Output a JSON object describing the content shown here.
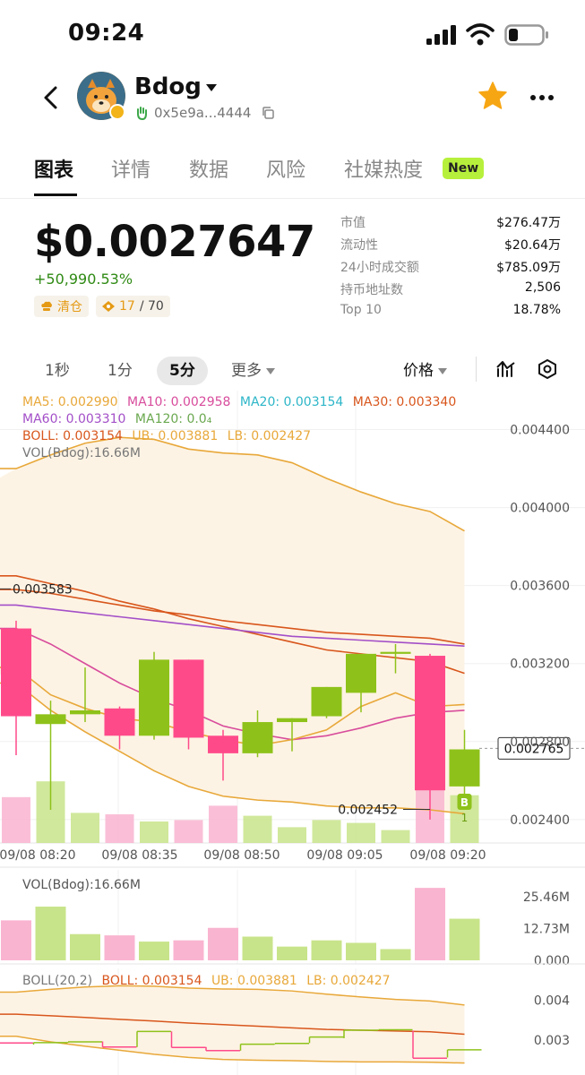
{
  "status_bar": {
    "time": "09:24"
  },
  "header": {
    "token_name": "Bdog",
    "address": "0x5e9a...4444"
  },
  "tabs": [
    {
      "label": "图表",
      "active": true
    },
    {
      "label": "详情",
      "active": false
    },
    {
      "label": "数据",
      "active": false
    },
    {
      "label": "风险",
      "active": false
    },
    {
      "label": "社媒热度",
      "active": false,
      "badge": "New"
    }
  ],
  "price": {
    "value": "$0.0027647",
    "change": "+50,990.53%",
    "pill_clear": "清仓",
    "pill_count": "17",
    "pill_total": "/ 70"
  },
  "stats": [
    {
      "label": "市值",
      "value": "$276.47万"
    },
    {
      "label": "流动性",
      "value": "$20.64万"
    },
    {
      "label": "24小时成交额",
      "value": "$785.09万"
    },
    {
      "label": "持币地址数",
      "value": "2,506"
    },
    {
      "label": "Top 10",
      "value": "18.78%"
    }
  ],
  "toolbar": {
    "intervals": [
      "1秒",
      "1分",
      "5分"
    ],
    "active_interval": "5分",
    "more": "更多",
    "price_mode": "价格"
  },
  "indicators": {
    "ma5": "MA5: 0.002990",
    "ma10": "MA10: 0.002958",
    "ma20": "MA20: 0.003154",
    "ma30": "MA30: 0.003340",
    "ma60": "MA60: 0.003310",
    "ma120": "MA120: 0.0₄",
    "boll": "BOLL: 0.003154",
    "ub": "UB: 0.003881",
    "lb": "LB: 0.002427",
    "vol": "VOL(Bdog):16.66M"
  },
  "colors": {
    "up": "#8ec21a",
    "down": "#ff4a8a",
    "ma5": "#e8a83a",
    "ma10": "#d84c9c",
    "ma20": "#2db6c8",
    "ma30": "#d8561c",
    "ma60": "#a34fc8",
    "ma120": "#6aa84f",
    "boll": "#d8561c",
    "band": "#e8a83a"
  },
  "chart_data": [
    {
      "type": "candlestick",
      "y_ticks": [
        "0.004400",
        "0.004000",
        "0.003600",
        "0.003200",
        "0.002800",
        "0.002400"
      ],
      "ylim": [
        0.00228,
        0.0046
      ],
      "x_ticks": [
        "09/08 08:20",
        "09/08 08:35",
        "09/08 08:50",
        "09/08 09:05",
        "09/08 09:20"
      ],
      "candles": [
        {
          "open": 0.00338,
          "high": 0.00342,
          "low": 0.00273,
          "close": 0.00293
        },
        {
          "open": 0.00289,
          "high": 0.00301,
          "low": 0.00245,
          "close": 0.00294
        },
        {
          "open": 0.00294,
          "high": 0.00318,
          "low": 0.0029,
          "close": 0.00296
        },
        {
          "open": 0.00297,
          "high": 0.00298,
          "low": 0.00276,
          "close": 0.00283
        },
        {
          "open": 0.00283,
          "high": 0.00326,
          "low": 0.00281,
          "close": 0.00322
        },
        {
          "open": 0.00322,
          "high": 0.00322,
          "low": 0.00276,
          "close": 0.00282
        },
        {
          "open": 0.00283,
          "high": 0.00286,
          "low": 0.0026,
          "close": 0.00274
        },
        {
          "open": 0.00274,
          "high": 0.00296,
          "low": 0.00272,
          "close": 0.0029
        },
        {
          "open": 0.0029,
          "high": 0.00292,
          "low": 0.00275,
          "close": 0.00292
        },
        {
          "open": 0.00293,
          "high": 0.00308,
          "low": 0.00292,
          "close": 0.00308
        },
        {
          "open": 0.00305,
          "high": 0.0032,
          "low": 0.00295,
          "close": 0.00325
        },
        {
          "open": 0.00325,
          "high": 0.0033,
          "low": 0.00315,
          "close": 0.00326
        },
        {
          "open": 0.00324,
          "high": 0.00325,
          "low": 0.0024,
          "close": 0.00255
        },
        {
          "open": 0.00257,
          "high": 0.00286,
          "low": 0.00245,
          "close": 0.00276
        }
      ],
      "volume": [
        16.0,
        21.5,
        10.5,
        10.0,
        7.5,
        8.0,
        13.0,
        9.5,
        5.5,
        8.0,
        7.0,
        4.5,
        29.0,
        16.66
      ],
      "ub": [
        0.0042,
        0.00427,
        0.00433,
        0.00436,
        0.00435,
        0.0043,
        0.00428,
        0.00427,
        0.00423,
        0.00415,
        0.00408,
        0.00402,
        0.00398,
        0.00388
      ],
      "lb": [
        0.0031,
        0.00296,
        0.00285,
        0.00275,
        0.00265,
        0.00257,
        0.00252,
        0.0025,
        0.00249,
        0.00247,
        0.00246,
        0.00246,
        0.00245,
        0.00243
      ],
      "boll": [
        0.00365,
        0.00361,
        0.00357,
        0.00352,
        0.00348,
        0.00343,
        0.00339,
        0.00335,
        0.00331,
        0.00327,
        0.00325,
        0.00323,
        0.00321,
        0.00315
      ],
      "ma30": [
        0.00358,
        0.00356,
        0.00353,
        0.0035,
        0.00347,
        0.00345,
        0.00342,
        0.0034,
        0.00338,
        0.00336,
        0.00335,
        0.00334,
        0.00333,
        0.0033
      ],
      "ma60": [
        0.0035,
        0.00348,
        0.00346,
        0.00344,
        0.00342,
        0.0034,
        0.00338,
        0.00336,
        0.00334,
        0.00333,
        0.00332,
        0.00331,
        0.0033,
        0.00329
      ],
      "ma10": [
        0.00338,
        0.0033,
        0.0032,
        0.0031,
        0.00302,
        0.00296,
        0.00288,
        0.00284,
        0.00281,
        0.00283,
        0.00287,
        0.00292,
        0.00295,
        0.00296
      ],
      "ma5": [
        0.00318,
        0.00304,
        0.00297,
        0.00292,
        0.0029,
        0.00285,
        0.00281,
        0.00278,
        0.00281,
        0.00286,
        0.00298,
        0.00305,
        0.00298,
        0.00299
      ],
      "high_label": "0.003583",
      "low_label": "0.002452",
      "current_label": "0.002765",
      "marker": "B",
      "marker_count": "1"
    },
    {
      "type": "bar",
      "title": "VOL(Bdog):16.66M",
      "y_ticks": [
        "25.46M",
        "12.73M",
        "0.000"
      ],
      "ylim": [
        0,
        25.46
      ]
    },
    {
      "type": "line",
      "title": "BOLL(20,2)",
      "boll": "BOLL: 0.003154",
      "ub": "UB: 0.003881",
      "lb": "LB: 0.002427",
      "y_ticks": [
        "0.004",
        "0.003"
      ]
    }
  ]
}
